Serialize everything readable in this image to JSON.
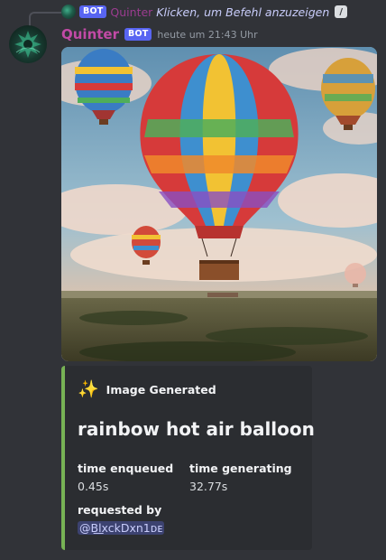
{
  "reply": {
    "bot_tag": "BOT",
    "username": "Quinter",
    "command_hint": "Klicken, um Befehl anzuzeigen",
    "command_icon": "slash-command-icon"
  },
  "message": {
    "username": "Quinter",
    "bot_tag": "BOT",
    "timestamp": "heute um 21:43 Uhr",
    "username_color": "#c24aa6"
  },
  "embed": {
    "accent_color": "#77b255",
    "author_icon": "sparkles-icon",
    "author": "Image Generated",
    "title": "rainbow hot air balloon",
    "fields": [
      {
        "name": "time enqueued",
        "value": "0.45s"
      },
      {
        "name": "time generating",
        "value": "32.77s"
      },
      {
        "name": "requested by",
        "value": "@B͟lxckDxn1ᴅᴇ"
      }
    ]
  }
}
